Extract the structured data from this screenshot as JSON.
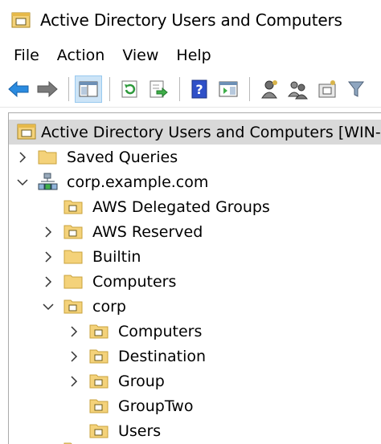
{
  "window": {
    "title": "Active Directory Users and Computers"
  },
  "menu": {
    "items": [
      "File",
      "Action",
      "View",
      "Help"
    ]
  },
  "toolbar": {
    "buttons": [
      "back-arrow-icon",
      "forward-arrow-icon",
      "console-tree-icon",
      "refresh-icon",
      "export-list-icon",
      "help-icon",
      "action-pane-icon",
      "user-icon",
      "group-icon",
      "ou-icon",
      "filter-icon"
    ]
  },
  "tree": {
    "root": "Active Directory Users and Computers [WIN-IL",
    "saved_queries": "Saved Queries",
    "domain": "corp.example.com",
    "aws_delegated_groups": "AWS Delegated Groups",
    "aws_reserved": "AWS Reserved",
    "builtin": "Builtin",
    "computers": "Computers",
    "corp": "corp",
    "corp_computers": "Computers",
    "destination": "Destination",
    "group": "Group",
    "grouptwo": "GroupTwo",
    "users": "Users"
  },
  "colors": {
    "folder": "#f4d27a",
    "folder_dark": "#c9a23b",
    "selected_row": "#d9d9d9",
    "back_arrow": "#1e7fd6"
  }
}
